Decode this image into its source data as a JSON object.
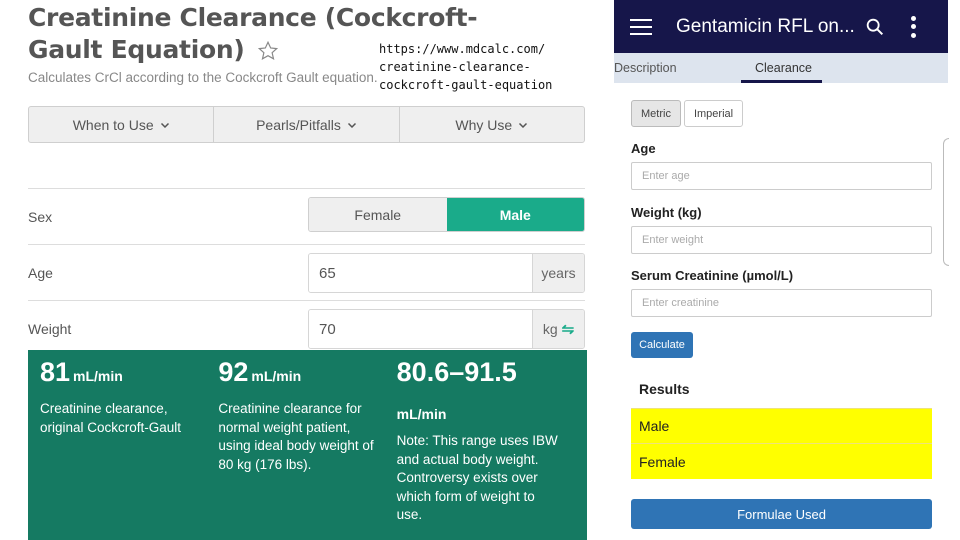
{
  "mdcalc": {
    "title": "Creatinine Clearance (Cockcroft-Gault Equation)",
    "subtitle": "Calculates CrCl according to the Cockcroft Gault equation.",
    "url_caption": [
      "https://www.mdcalc.com/",
      "creatinine-clearance-",
      "cockcroft-gault-equation"
    ],
    "accordion": [
      {
        "label": "When to Use"
      },
      {
        "label": "Pearls/Pitfalls"
      },
      {
        "label": "Why Use"
      }
    ],
    "sex": {
      "label": "Sex",
      "options": [
        "Female",
        "Male"
      ],
      "selected": "Male"
    },
    "age": {
      "label": "Age",
      "value": "65",
      "unit": "years"
    },
    "weight": {
      "label": "Weight",
      "value": "70",
      "unit": "kg"
    },
    "results": [
      {
        "value": "81",
        "unit": "mL/min",
        "description": "Creatinine clearance, original Cockcroft-Gault"
      },
      {
        "value": "92",
        "unit": "mL/min",
        "description": "Creatinine clearance for normal weight patient, using ideal body weight of 80 kg (176 lbs)."
      },
      {
        "value": "80.6–91.5",
        "unit": "mL/min",
        "description": "Note: This range uses IBW and actual body weight. Controversy exists over which form of weight to use."
      }
    ],
    "colors": {
      "accent": "#1aab8a",
      "results_bg": "#157a62"
    }
  },
  "app": {
    "title": "Gentamicin RFL on...",
    "tabs": [
      {
        "label": "Description",
        "active": false
      },
      {
        "label": "Clearance",
        "active": true
      }
    ],
    "unit_buttons": [
      {
        "label": "Metric",
        "active": true
      },
      {
        "label": "Imperial",
        "active": false
      }
    ],
    "fields": [
      {
        "label": "Age",
        "placeholder": "Enter age"
      },
      {
        "label": "Weight (kg)",
        "placeholder": "Enter weight"
      },
      {
        "label": "Serum Creatinine (µmol/L)",
        "placeholder": "Enter creatinine"
      }
    ],
    "calculate_label": "Calculate",
    "results_heading": "Results",
    "results": [
      {
        "label": "Male"
      },
      {
        "label": "Female"
      }
    ],
    "formulae_label": "Formulae Used",
    "colors": {
      "appbar": "#16164a",
      "tabbar": "#dde4ee",
      "button": "#2f74b5",
      "highlight": "#ffff00"
    }
  }
}
